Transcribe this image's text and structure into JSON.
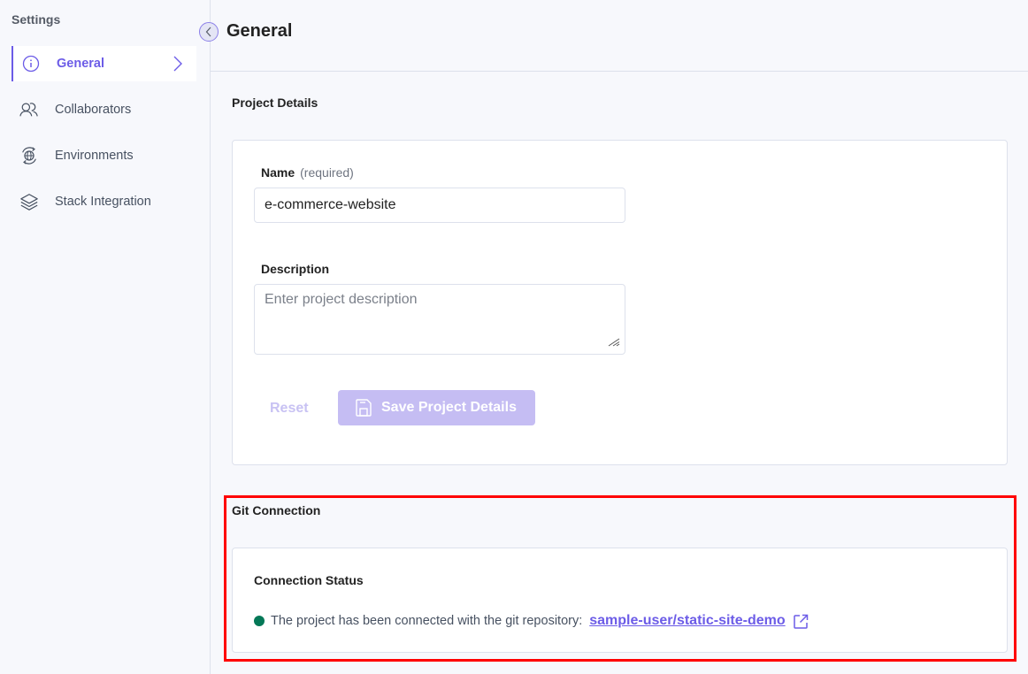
{
  "sidebar": {
    "title": "Settings",
    "items": [
      {
        "label": "General",
        "icon": "info-icon",
        "active": true
      },
      {
        "label": "Collaborators",
        "icon": "users-icon",
        "active": false
      },
      {
        "label": "Environments",
        "icon": "globe-sync-icon",
        "active": false
      },
      {
        "label": "Stack Integration",
        "icon": "layers-icon",
        "active": false
      }
    ]
  },
  "header": {
    "title": "General",
    "collapse_icon": "chevron-left-icon"
  },
  "project_details": {
    "section_title": "Project Details",
    "name_label": "Name",
    "name_required": "(required)",
    "name_value": "e-commerce-website",
    "description_label": "Description",
    "description_value": "",
    "description_placeholder": "Enter project description",
    "reset_label": "Reset",
    "save_label": "Save Project Details",
    "save_icon": "floppy-disk-icon"
  },
  "git_connection": {
    "section_title": "Git Connection",
    "status_title": "Connection Status",
    "status_text": "The project has been connected with the git repository:",
    "repo_link": "sample-user/static-site-demo",
    "status_color": "#047857",
    "link_icon": "external-link-icon"
  },
  "colors": {
    "accent": "#6c5ce7",
    "disabled_button": "#c5bdf3",
    "highlight": "#ff0000"
  }
}
